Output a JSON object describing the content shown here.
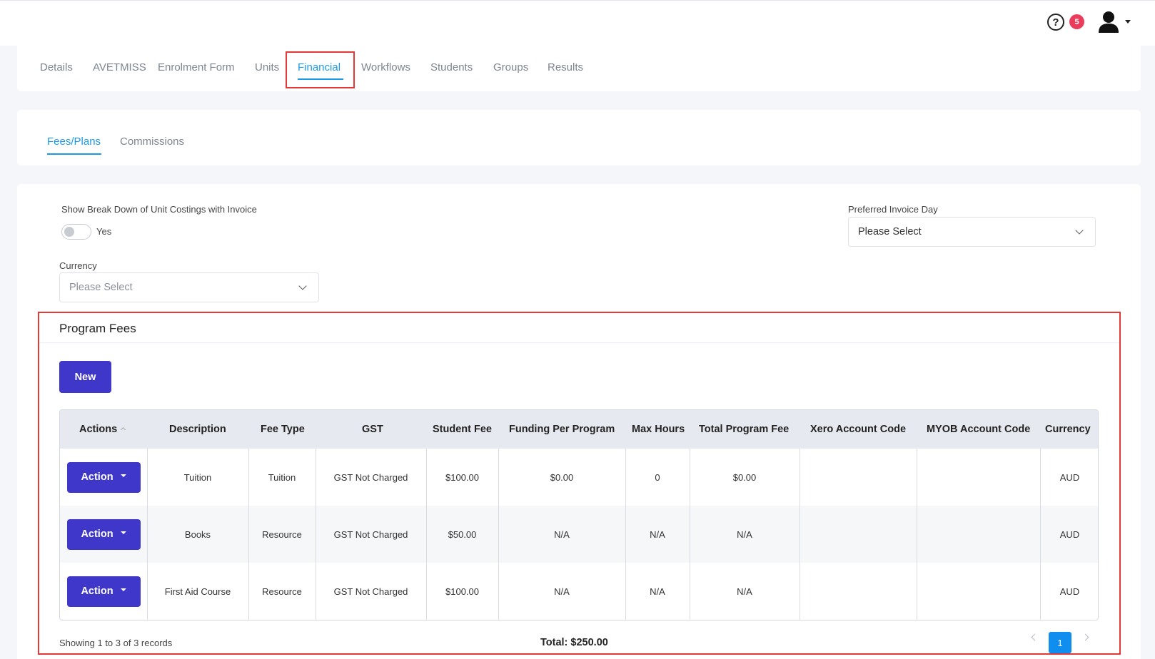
{
  "header": {
    "help_icon_glyph": "?",
    "notification_count": "5"
  },
  "tabs": {
    "items": [
      "Details",
      "AVETMISS",
      "Enrolment Form",
      "Units",
      "Financial",
      "Workflows",
      "Students",
      "Groups",
      "Results"
    ],
    "active": "Financial"
  },
  "subtabs": {
    "items": [
      "Fees/Plans",
      "Commissions"
    ],
    "active": "Fees/Plans"
  },
  "settings": {
    "breakdown_label": "Show Break Down of Unit Costings with Invoice",
    "breakdown_toggle_label": "Yes",
    "breakdown_enabled": false,
    "invoice_day_label": "Preferred Invoice Day",
    "invoice_day_value": "Please Select",
    "currency_label": "Currency",
    "currency_placeholder": "Please Select"
  },
  "program_fees": {
    "title": "Program Fees",
    "new_button": "New",
    "columns": [
      "Actions",
      "Description",
      "Fee Type",
      "GST",
      "Student Fee",
      "Funding Per Program",
      "Max Hours",
      "Total Program Fee",
      "Xero Account Code",
      "MYOB Account Code",
      "Currency"
    ],
    "action_label": "Action",
    "rows": [
      {
        "description": "Tuition",
        "fee_type": "Tuition",
        "gst": "GST Not Charged",
        "student_fee": "$100.00",
        "funding": "$0.00",
        "max_hours": "0",
        "total_fee": "$0.00",
        "xero": "",
        "myob": "",
        "currency": "AUD"
      },
      {
        "description": "Books",
        "fee_type": "Resource",
        "gst": "GST Not Charged",
        "student_fee": "$50.00",
        "funding": "N/A",
        "max_hours": "N/A",
        "total_fee": "N/A",
        "xero": "",
        "myob": "",
        "currency": "AUD"
      },
      {
        "description": "First Aid Course",
        "fee_type": "Resource",
        "gst": "GST Not Charged",
        "student_fee": "$100.00",
        "funding": "N/A",
        "max_hours": "N/A",
        "total_fee": "N/A",
        "xero": "",
        "myob": "",
        "currency": "AUD"
      }
    ],
    "showing_text": "Showing 1 to 3 of 3 records",
    "total_text": "Total: $250.00",
    "current_page": "1"
  },
  "colors": {
    "primary_button": "#3f37c9",
    "active_tab": "#1a9be8",
    "badge": "#ea3c5b",
    "highlight": "#e53935",
    "page_button": "#0f8ef0"
  }
}
